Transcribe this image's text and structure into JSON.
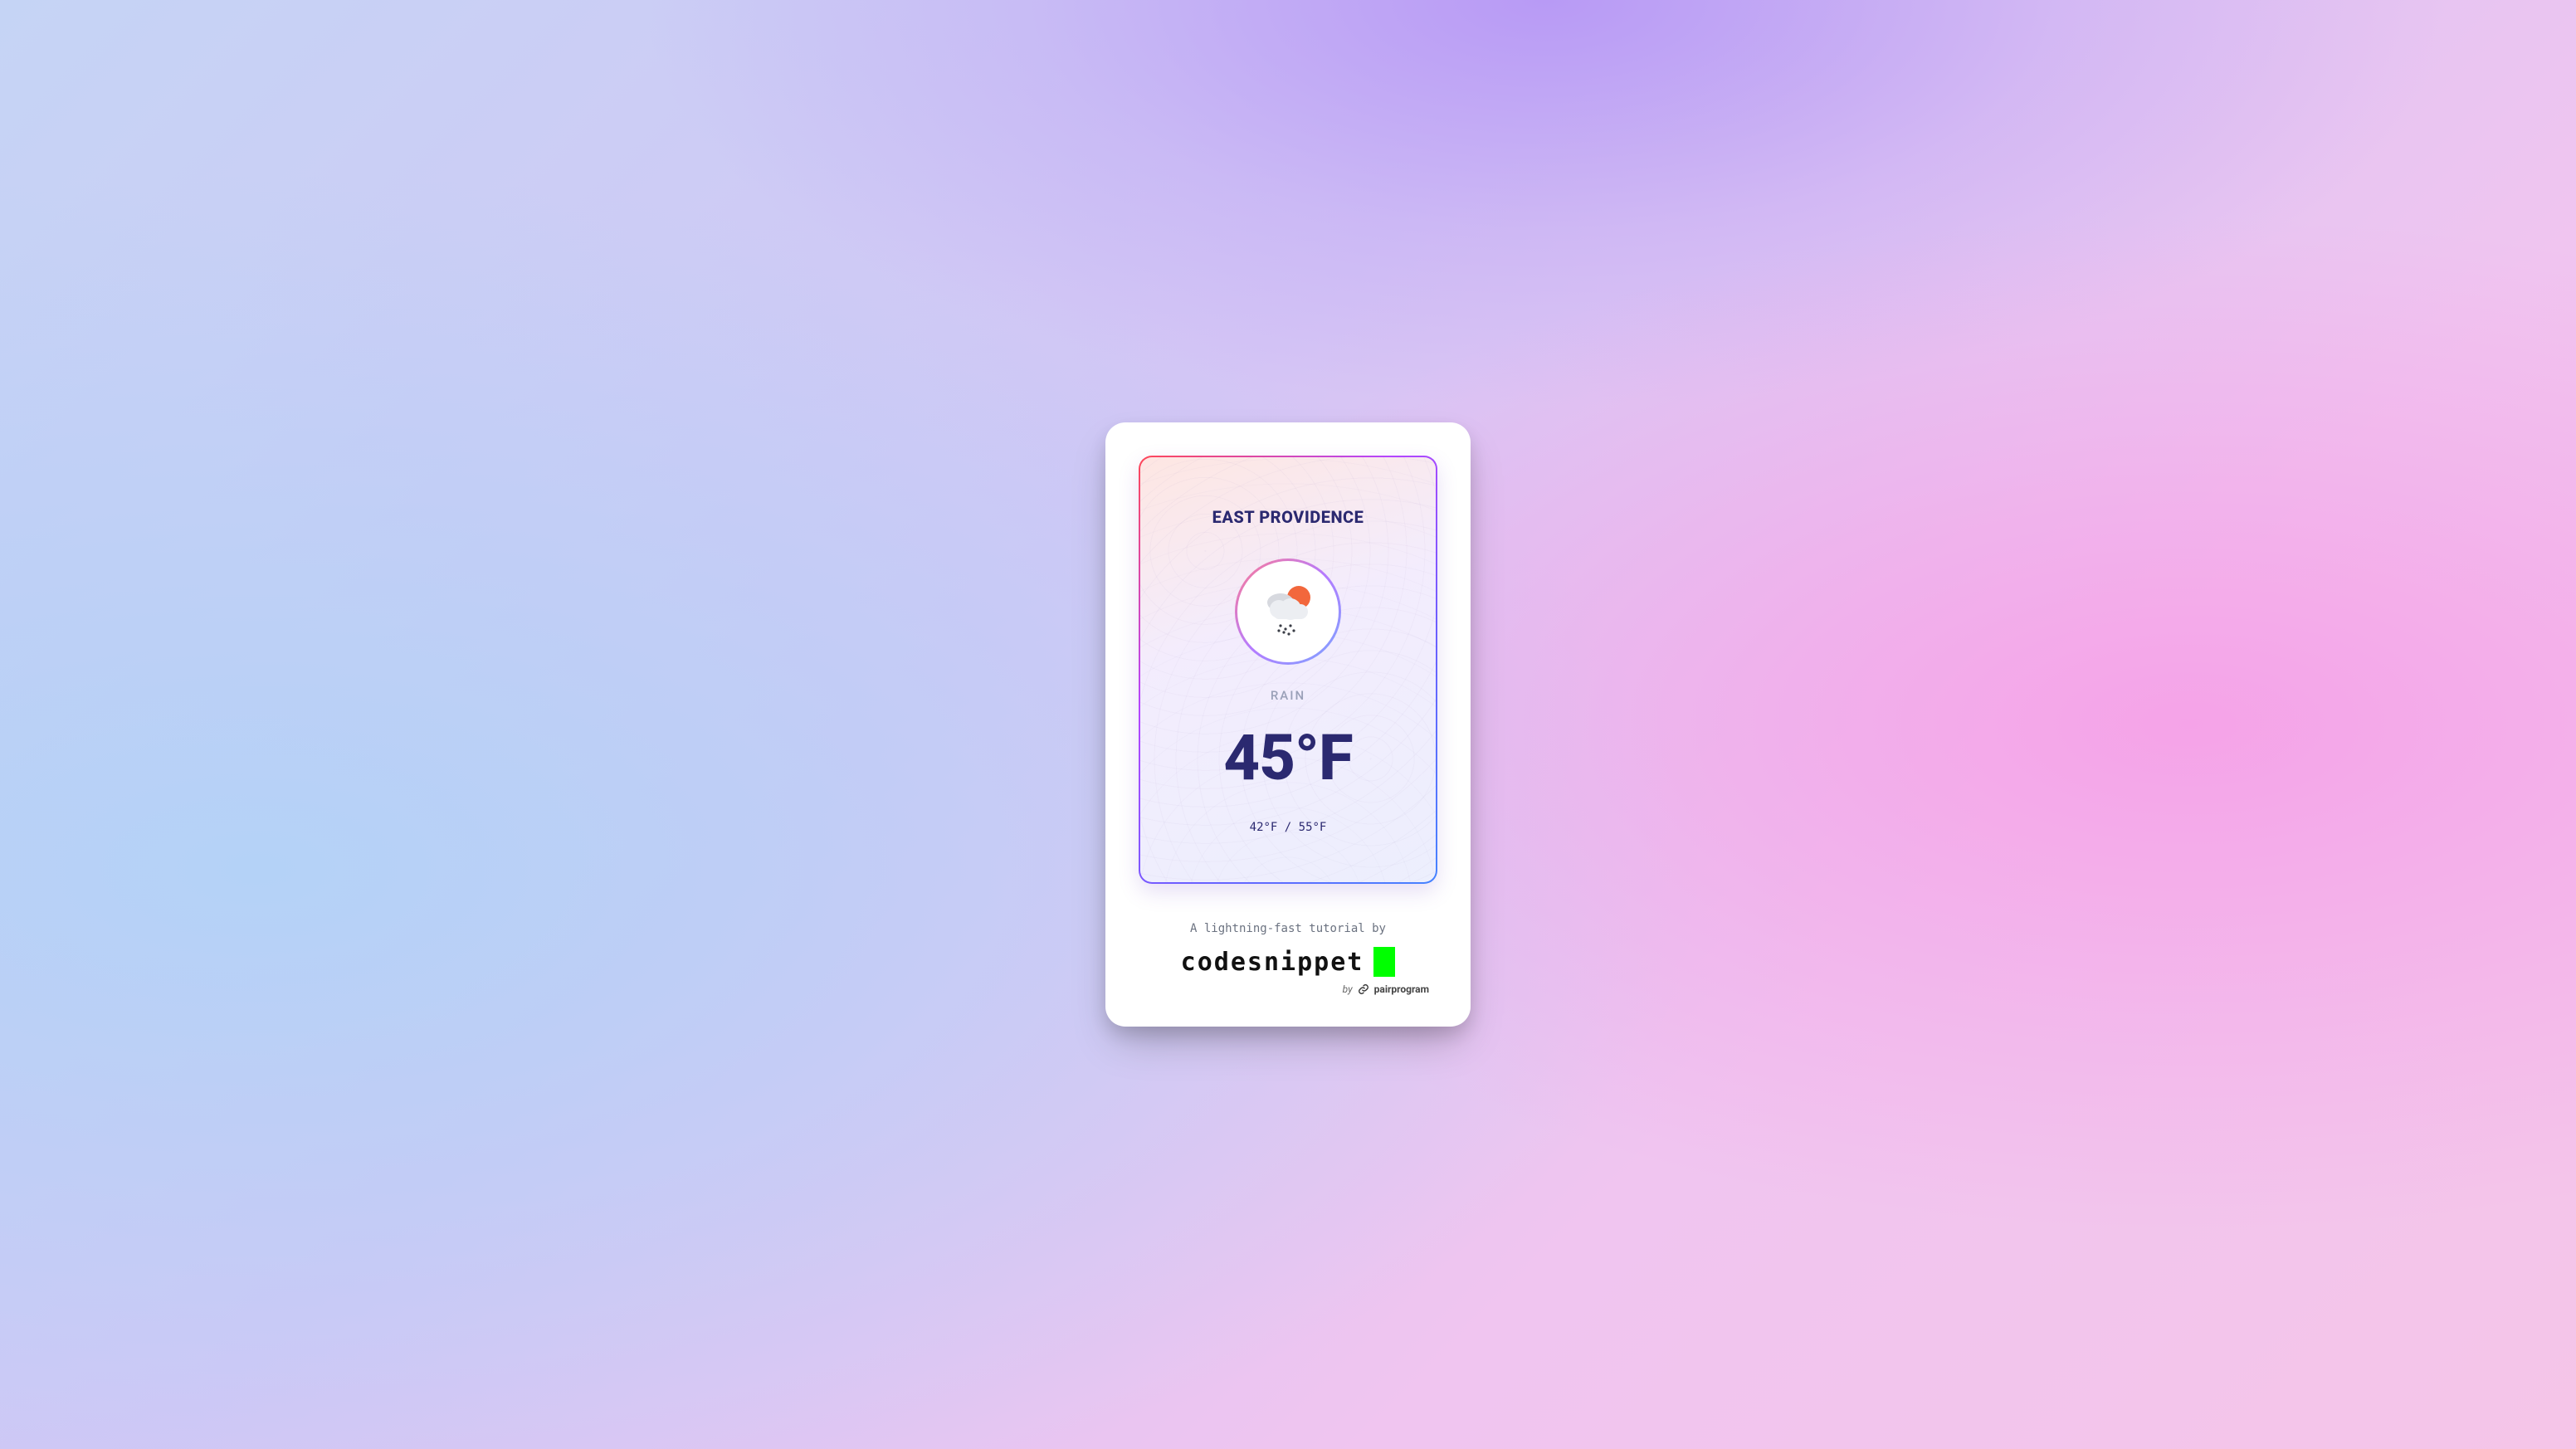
{
  "weather": {
    "location": "EAST PROVIDENCE",
    "condition": "RAIN",
    "temp_display": "45°F",
    "range_display": "42°F / 55°F",
    "icon": "rain-sun-cloud-icon"
  },
  "footer": {
    "tagline": "A lightning-fast tutorial by",
    "brand": "codesnippet",
    "by_prefix": "by",
    "by_name": "pairprogram"
  },
  "colors": {
    "text_primary": "#2b2970",
    "text_muted": "#9aa0b8",
    "accent_cursor": "#00ff00"
  }
}
